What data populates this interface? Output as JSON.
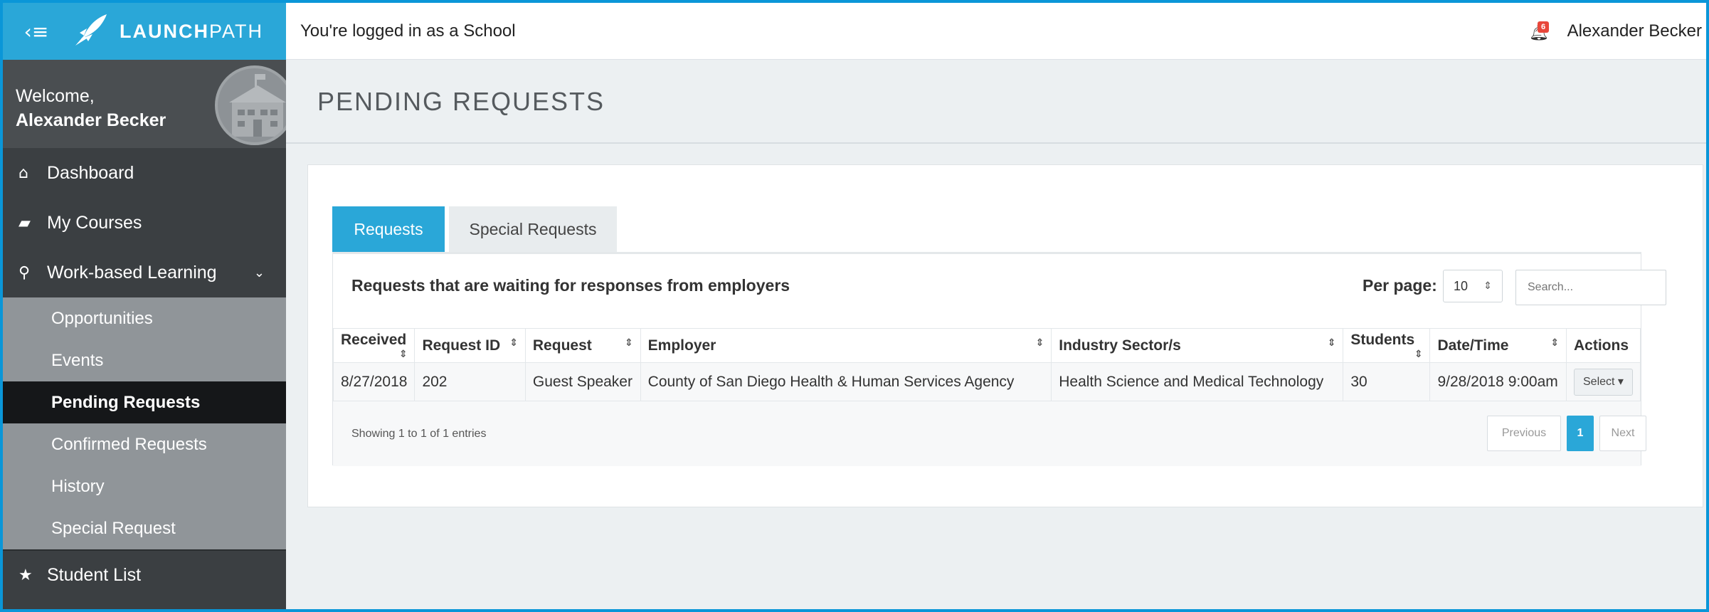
{
  "brand": {
    "name_bold": "LAUNCH",
    "name_light": "PATH"
  },
  "topbar": {
    "logged_in_text": "You're logged in as a School",
    "notification_count": "6",
    "user_name": "Alexander Becker"
  },
  "welcome": {
    "greeting": "Welcome,",
    "name": "Alexander Becker"
  },
  "sidebar": {
    "items": [
      {
        "icon": "home-icon",
        "label": "Dashboard"
      },
      {
        "icon": "book-icon",
        "label": "My Courses"
      },
      {
        "icon": "sitemap-icon",
        "label": "Work-based Learning"
      }
    ],
    "subitems": [
      {
        "label": "Opportunities"
      },
      {
        "label": "Events"
      },
      {
        "label": "Pending Requests"
      },
      {
        "label": "Confirmed Requests"
      },
      {
        "label": "History"
      },
      {
        "label": "Special Request"
      }
    ],
    "bottom_item": {
      "icon": "star-icon",
      "label": "Student List"
    }
  },
  "page": {
    "title": "PENDING REQUESTS"
  },
  "tabs": [
    {
      "label": "Requests"
    },
    {
      "label": "Special Requests"
    }
  ],
  "panel": {
    "description": "Requests that are waiting for responses from employers",
    "per_page_label": "Per page:",
    "per_page_value": "10",
    "search_placeholder": "Search..."
  },
  "table": {
    "headers": [
      "Received",
      "Request ID",
      "Request",
      "Employer",
      "Industry Sector/s",
      "Students",
      "Date/Time",
      "Actions"
    ],
    "rows": [
      {
        "received": "8/27/2018",
        "request_id": "202",
        "request": "Guest Speaker",
        "employer": "County of San Diego Health & Human Services Agency",
        "industry": "Health Science and Medical Technology",
        "students": "30",
        "datetime": "9/28/2018 9:00am",
        "action": "Select"
      }
    ]
  },
  "footer": {
    "showing": "Showing 1 to 1 of 1 entries",
    "prev": "Previous",
    "current_page": "1",
    "next": "Next"
  },
  "colors": {
    "accent": "#2aa7d8",
    "sidebar": "#3b3f42",
    "subnav": "#909599",
    "active_sub": "#151719"
  }
}
